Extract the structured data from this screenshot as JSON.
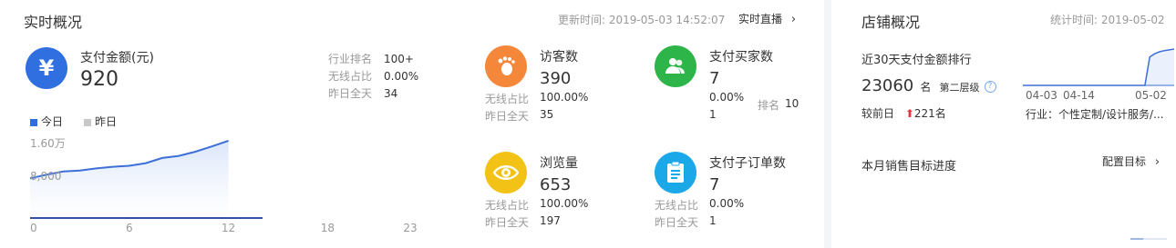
{
  "left": {
    "title": "实时概况",
    "update_label": "更新时间:",
    "update_time": "2019-05-03 14:52:07",
    "live_link": "实时直播",
    "pay": {
      "label": "支付金额(元)",
      "value": "920",
      "stats": [
        {
          "label": "行业排名",
          "value": "100+"
        },
        {
          "label": "无线占比",
          "value": "0.00%"
        },
        {
          "label": "昨日全天",
          "value": "34"
        }
      ]
    },
    "legend": {
      "today": "今日",
      "yesterday": "昨日"
    },
    "chart_data": {
      "type": "area",
      "series": [
        {
          "name": "今日",
          "x": [
            0,
            1,
            2,
            3,
            4,
            5,
            6,
            7,
            8,
            9,
            10,
            11,
            12
          ],
          "values": [
            7600,
            8300,
            8900,
            9100,
            9500,
            9800,
            10000,
            10500,
            11500,
            11900,
            12700,
            13700,
            14800
          ]
        }
      ],
      "yticks": [
        "8,000",
        "1.60万"
      ],
      "xticks": [
        "0",
        "6",
        "12",
        "18",
        "23"
      ],
      "ylim": [
        0,
        16000
      ],
      "xlim": [
        0,
        23
      ],
      "colors": {
        "line": "#3d6fd8",
        "fill": "#dbe6fa"
      }
    },
    "metrics": [
      {
        "name": "访客数",
        "value": "390",
        "icon": "footprint-icon",
        "color": "#f5873a",
        "rows": [
          {
            "label": "无线占比",
            "value": "100.00%"
          },
          {
            "label": "昨日全天",
            "value": "35"
          }
        ]
      },
      {
        "name": "支付买家数",
        "value": "7",
        "icon": "users-icon",
        "color": "#2db54a",
        "rows": [
          {
            "label": "",
            "value": "0.00%"
          },
          {
            "label": "",
            "value": "1"
          }
        ],
        "rank_label": "排名",
        "rank_value": "10"
      },
      {
        "name": "浏览量",
        "value": "653",
        "icon": "eye-icon",
        "color": "#f2c316",
        "rows": [
          {
            "label": "无线占比",
            "value": "100.00%"
          },
          {
            "label": "昨日全天",
            "value": "197"
          }
        ]
      },
      {
        "name": "支付子订单数",
        "value": "7",
        "icon": "clipboard-icon",
        "color": "#1ba8e8",
        "rows": [
          {
            "label": "无线占比",
            "value": "0.00%"
          },
          {
            "label": "昨日全天",
            "value": "1"
          }
        ]
      }
    ]
  },
  "right": {
    "title": "店铺概况",
    "stat_label": "统计时间:",
    "stat_date": "2019-05-02",
    "rank_title": "近30天支付金额排行",
    "amount": "23060",
    "unit": "名",
    "level": "第二层级",
    "compare_label": "较前日",
    "compare_value": "221名",
    "industry": "行业：个性定制/设计服务/...",
    "mini_chart": {
      "type": "line",
      "xticks": [
        "04-03",
        "04-14",
        "05-02"
      ],
      "values": [
        0,
        0,
        0,
        0,
        0,
        0,
        0,
        0,
        0,
        0,
        0,
        0,
        0,
        0,
        0,
        0,
        0,
        0,
        0,
        0,
        0,
        0,
        0,
        0,
        0,
        0,
        72,
        80,
        85,
        88,
        90,
        92
      ]
    },
    "target_label": "本月销售目标进度",
    "target_link": "配置目标"
  }
}
